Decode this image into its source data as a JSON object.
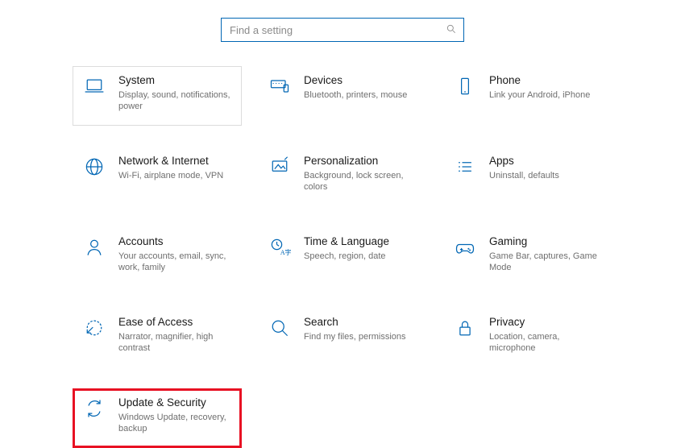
{
  "search": {
    "placeholder": "Find a setting"
  },
  "tiles": {
    "system": {
      "title": "System",
      "sub": "Display, sound, notifications, power"
    },
    "devices": {
      "title": "Devices",
      "sub": "Bluetooth, printers, mouse"
    },
    "phone": {
      "title": "Phone",
      "sub": "Link your Android, iPhone"
    },
    "network": {
      "title": "Network & Internet",
      "sub": "Wi-Fi, airplane mode, VPN"
    },
    "personalization": {
      "title": "Personalization",
      "sub": "Background, lock screen, colors"
    },
    "apps": {
      "title": "Apps",
      "sub": "Uninstall, defaults"
    },
    "accounts": {
      "title": "Accounts",
      "sub": "Your accounts, email, sync, work, family"
    },
    "time": {
      "title": "Time & Language",
      "sub": "Speech, region, date"
    },
    "gaming": {
      "title": "Gaming",
      "sub": "Game Bar, captures, Game Mode"
    },
    "ease": {
      "title": "Ease of Access",
      "sub": "Narrator, magnifier, high contrast"
    },
    "search_cat": {
      "title": "Search",
      "sub": "Find my files, permissions"
    },
    "privacy": {
      "title": "Privacy",
      "sub": "Location, camera, microphone"
    },
    "update": {
      "title": "Update & Security",
      "sub": "Windows Update, recovery, backup"
    }
  }
}
